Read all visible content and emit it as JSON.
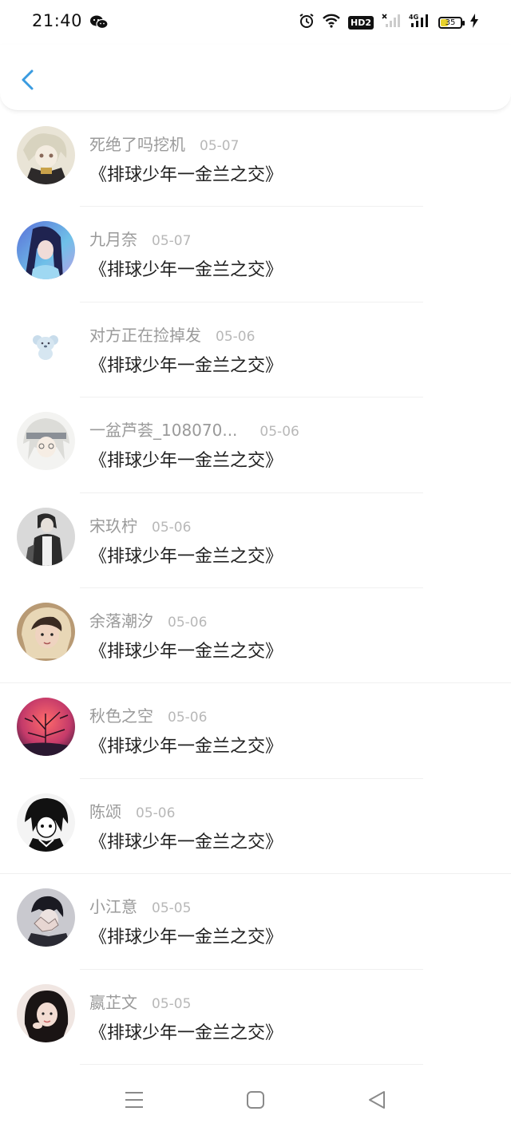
{
  "status_bar": {
    "time": "21:40",
    "network": "4G",
    "hd_label": "HD2",
    "battery": "35"
  },
  "header": {
    "back_icon": "chevron-left-icon"
  },
  "items": [
    {
      "name": "死绝了吗挖机",
      "date": "05-07",
      "title": "《排球少年一金兰之交》"
    },
    {
      "name": "九月奈",
      "date": "05-07",
      "title": "《排球少年一金兰之交》"
    },
    {
      "name": "对方正在捡掉发",
      "date": "05-06",
      "title": "《排球少年一金兰之交》"
    },
    {
      "name": "一盆芦荟_108070...",
      "date": "05-06",
      "title": "《排球少年一金兰之交》"
    },
    {
      "name": "宋玖柠",
      "date": "05-06",
      "title": "《排球少年一金兰之交》"
    },
    {
      "name": "余落潮汐",
      "date": "05-06",
      "title": "《排球少年一金兰之交》"
    },
    {
      "name": "秋色之空",
      "date": "05-06",
      "title": "《排球少年一金兰之交》"
    },
    {
      "name": "陈颂",
      "date": "05-06",
      "title": "《排球少年一金兰之交》"
    },
    {
      "name": "小江意",
      "date": "05-05",
      "title": "《排球少年一金兰之交》"
    },
    {
      "name": "嬴芷文",
      "date": "05-05",
      "title": "《排球少年一金兰之交》"
    }
  ],
  "navbar": {
    "menu_icon": "menu-icon",
    "home_icon": "home-square-icon",
    "back_icon": "back-triangle-icon"
  },
  "colors": {
    "accent": "#3a9be0",
    "name_text": "#9a9a9a",
    "date_text": "#b8b8b8",
    "title_text": "#222222"
  }
}
